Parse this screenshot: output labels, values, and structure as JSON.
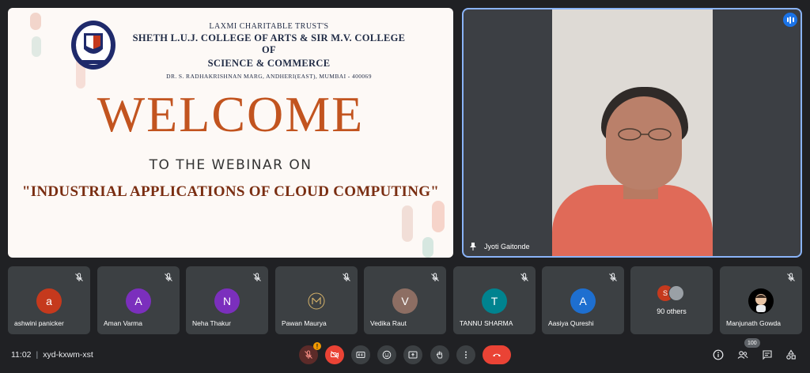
{
  "slide": {
    "trust_name": "LAXMI CHARITABLE TRUST'S",
    "college_line1": "SHETH L.U.J. COLLEGE OF ARTS & SIR M.V. COLLEGE OF",
    "college_line2": "SCIENCE & COMMERCE",
    "address": "DR. S. RADHAKRISHNAN MARG, ANDHERI(EAST), MUMBAI - 400069",
    "welcome": "WELCOME",
    "subtitle": "TO THE WEBINAR ON",
    "topic": "\"INDUSTRIAL APPLICATIONS OF CLOUD COMPUTING\""
  },
  "speaker": {
    "name": "Jyoti Gaitonde",
    "pin_icon": "pin-icon",
    "speaking_icon": "audio-level-icon"
  },
  "participants": [
    {
      "name": "ashwini panicker",
      "initial": "a",
      "color": "#c5391d"
    },
    {
      "name": "Aman Varma",
      "initial": "A",
      "color": "#7b2fbd"
    },
    {
      "name": "Neha Thakur",
      "initial": "N",
      "color": "#7b2fbd"
    },
    {
      "name": "Pawan Maurya",
      "initial": "",
      "color": "#111111"
    },
    {
      "name": "Vedika Raut",
      "initial": "V",
      "color": "#8d6e63"
    },
    {
      "name": "TANNU SHARMA",
      "initial": "T",
      "color": "#00838f"
    },
    {
      "name": "Aasiya Qureshi",
      "initial": "A",
      "color": "#1e6fd0"
    }
  ],
  "others": {
    "label": "90 others",
    "initial": "S",
    "color": "#c5391d"
  },
  "last_participant": {
    "name": "Manjunath Gowda"
  },
  "bottom_bar": {
    "time": "11:02",
    "separator": "|",
    "meeting_code": "xyd-kxwm-xst",
    "warning_badge": "!",
    "people_count": "100"
  }
}
